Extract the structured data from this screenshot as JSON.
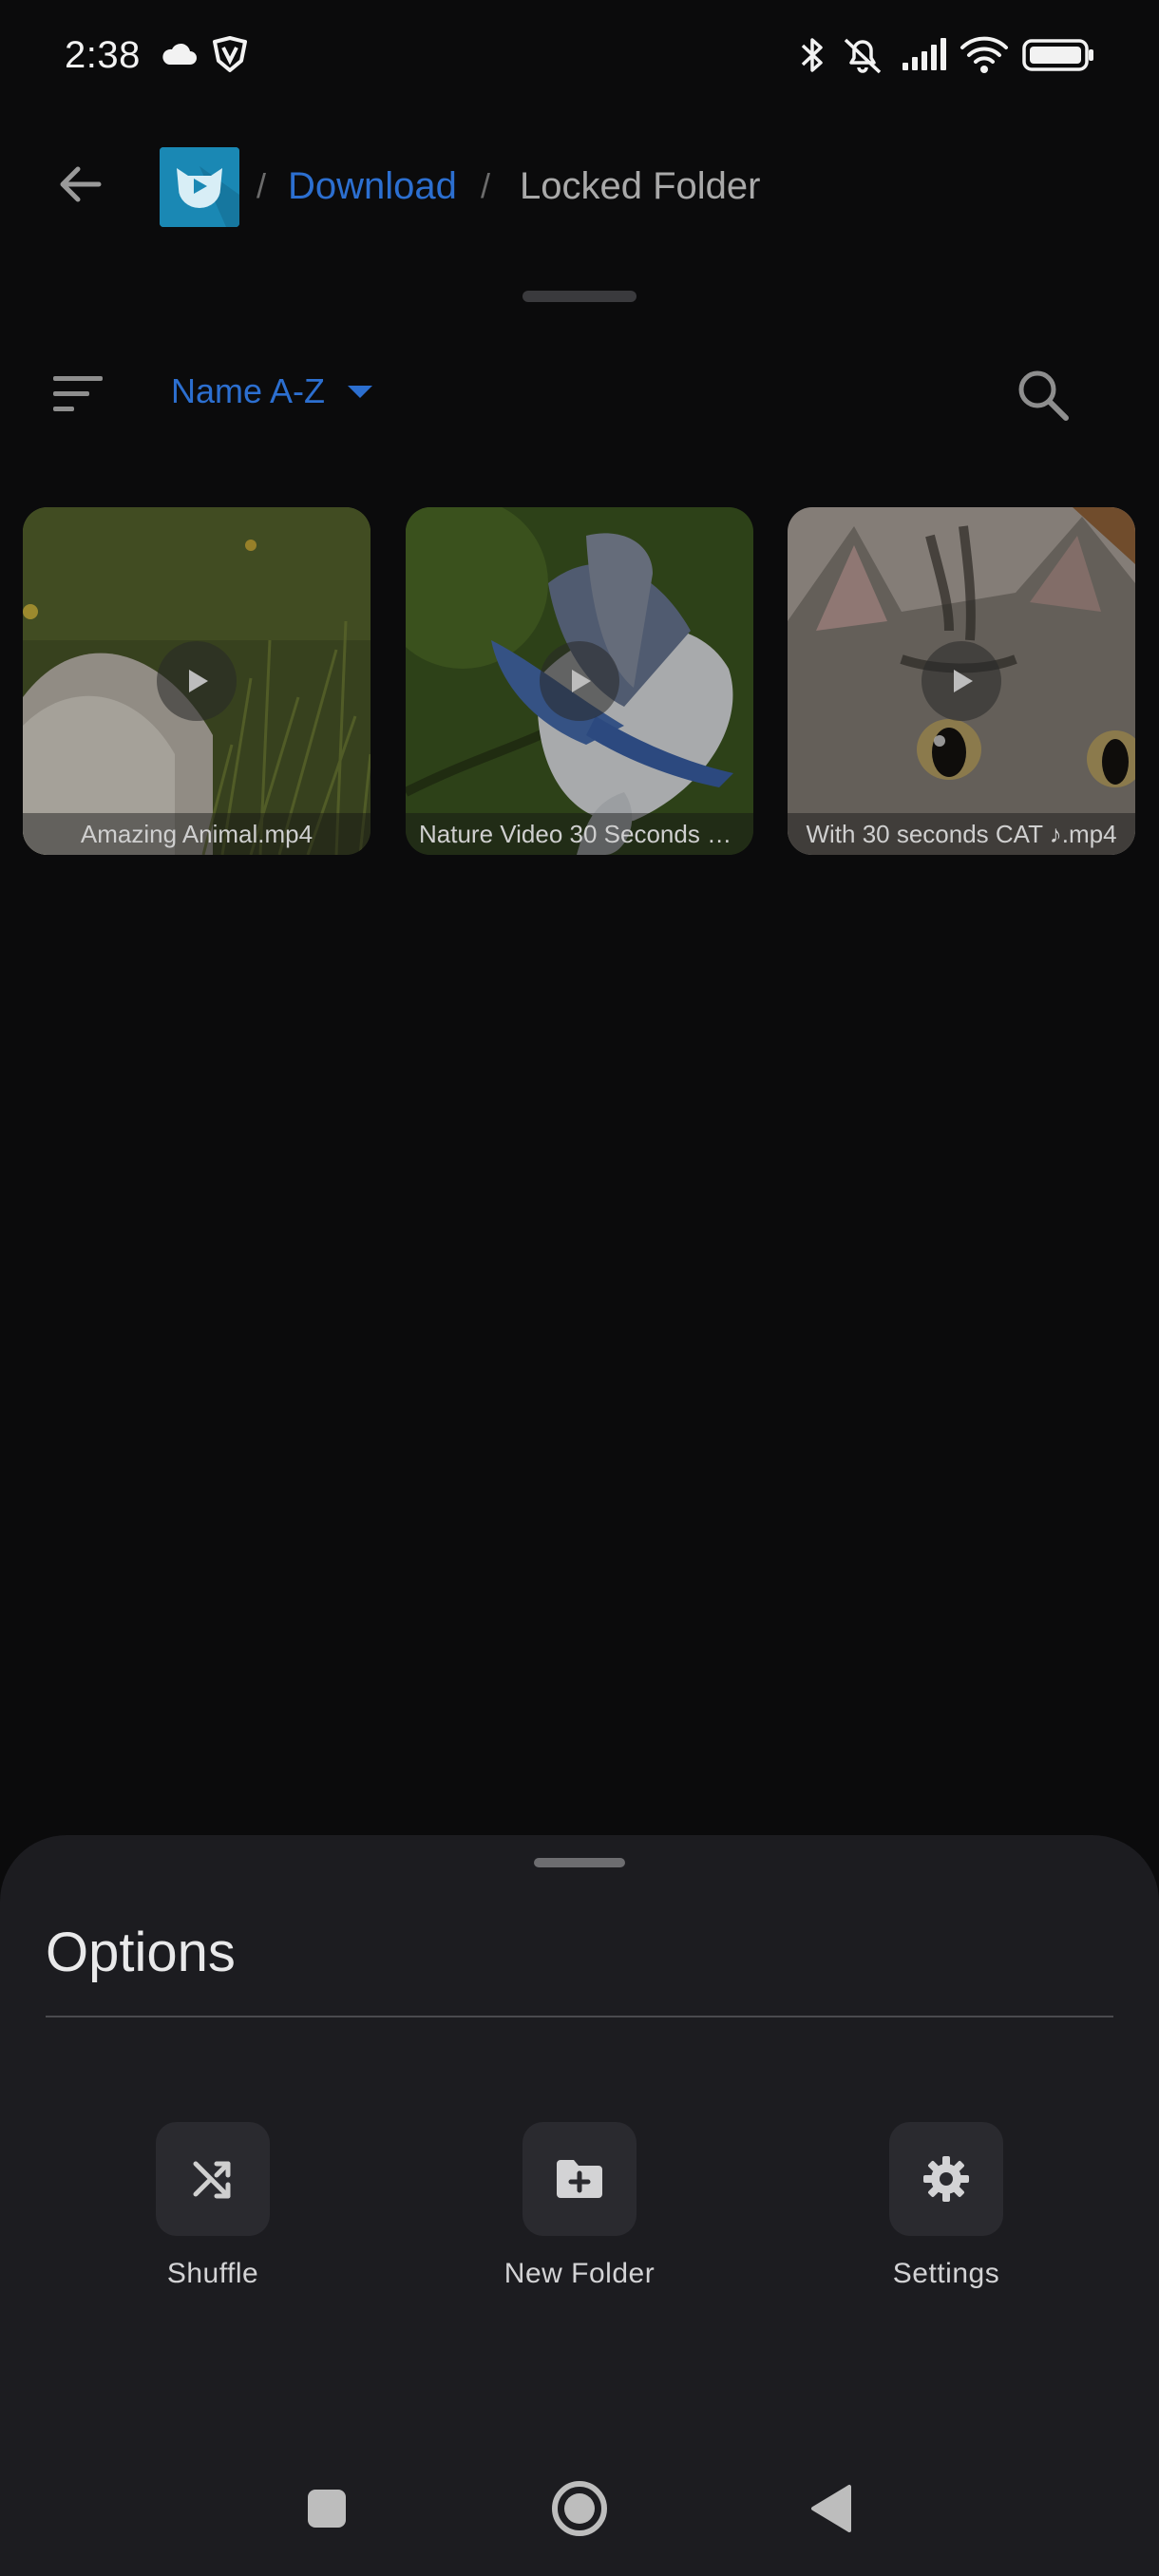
{
  "status_bar": {
    "time": "2:38",
    "icons": [
      "cloud-icon",
      "shield-v-icon",
      "bluetooth-icon",
      "bell-off-icon",
      "signal-icon",
      "wifi-icon",
      "battery-icon"
    ]
  },
  "header": {
    "back_icon": "arrow-left-icon",
    "app_icon": "fox-play-logo",
    "breadcrumb": {
      "separator": "/",
      "items": [
        "Download",
        "Locked Folder"
      ]
    }
  },
  "sort_bar": {
    "sort_icon": "sort-lines-icon",
    "sort_label": "Name A-Z",
    "search_icon": "search-icon"
  },
  "videos": [
    {
      "title": "Amazing Animal.mp4"
    },
    {
      "title": "Nature Video 30 Seconds W..."
    },
    {
      "title": "With 30 seconds CAT ♪.mp4"
    }
  ],
  "options_sheet": {
    "title": "Options",
    "items": [
      {
        "label": "Shuffle",
        "icon": "shuffle-icon"
      },
      {
        "label": "New Folder",
        "icon": "folder-plus-icon"
      },
      {
        "label": "Settings",
        "icon": "gear-icon"
      }
    ]
  },
  "nav_bar": {
    "icons": [
      "recents-square-icon",
      "home-circle-icon",
      "back-triangle-icon"
    ]
  },
  "colors": {
    "accent": "#2c6fd0",
    "background": "#0b0b0c",
    "sheet": "#1c1c20",
    "logo": "#1a88b4"
  }
}
